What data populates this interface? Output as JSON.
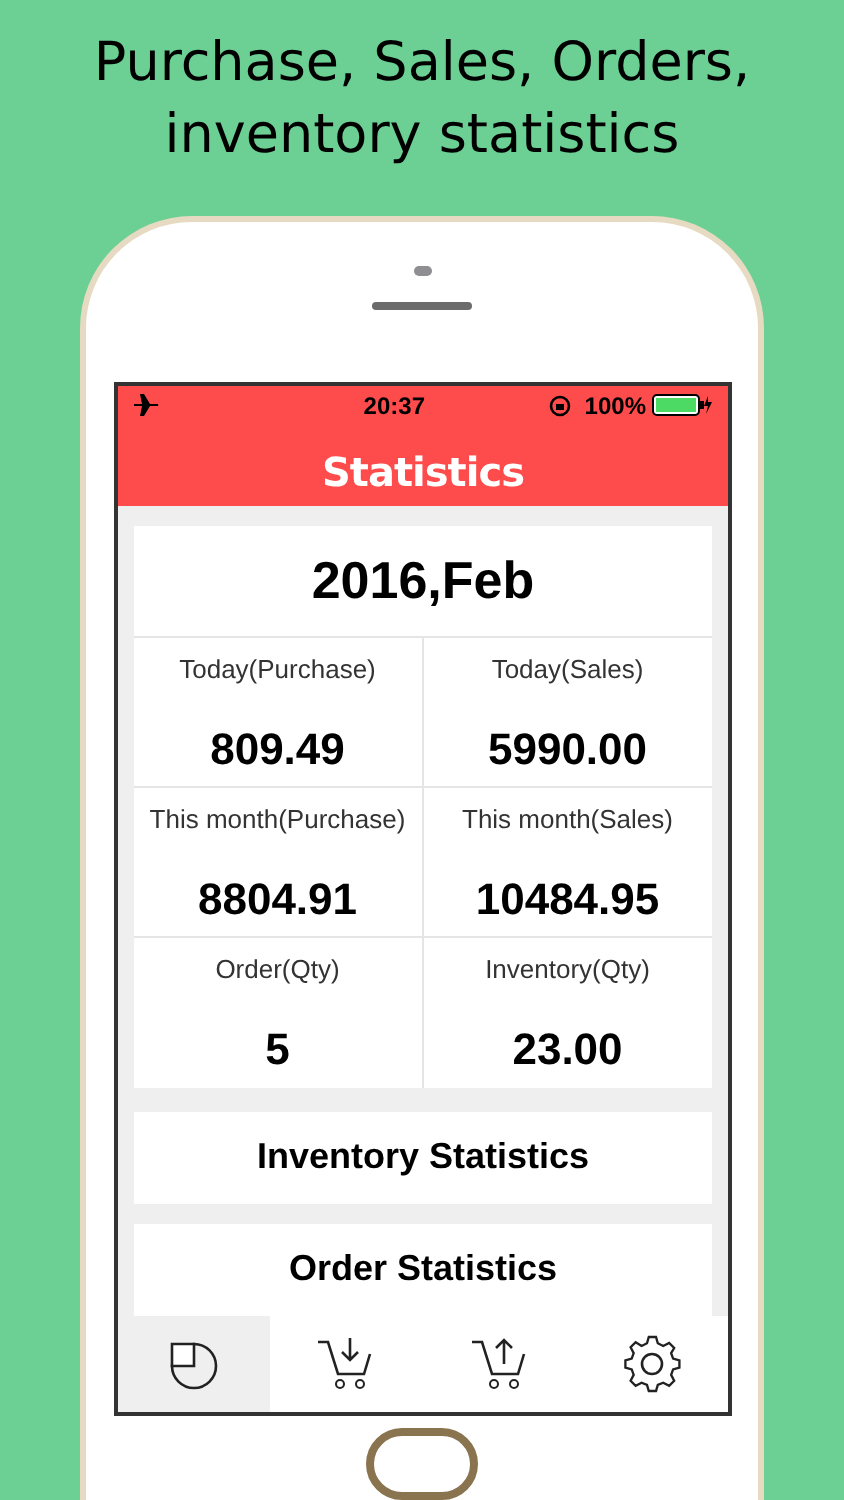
{
  "headline": [
    "Purchase, Sales, Orders,",
    "inventory statistics"
  ],
  "status_bar": {
    "time": "20:37",
    "battery": "100%"
  },
  "nav_bar": {
    "title": "Statistics"
  },
  "summary": {
    "period": "2016,Feb",
    "rows": [
      [
        {
          "label": "Today(Purchase)",
          "value": "809.49"
        },
        {
          "label": "Today(Sales)",
          "value": "5990.00"
        }
      ],
      [
        {
          "label": "This month(Purchase)",
          "value": "8804.91"
        },
        {
          "label": "This month(Sales)",
          "value": "10484.95"
        }
      ],
      [
        {
          "label": "Order(Qty)",
          "value": "5"
        },
        {
          "label": "Inventory(Qty)",
          "value": "23.00"
        }
      ]
    ]
  },
  "buttons": [
    "Inventory Statistics",
    "Order Statistics"
  ],
  "tab_bar": [
    {
      "kind": "chart",
      "selected": true
    },
    {
      "kind": "purchase",
      "selected": false
    },
    {
      "kind": "sales",
      "selected": false
    },
    {
      "kind": "settings",
      "selected": false
    }
  ]
}
